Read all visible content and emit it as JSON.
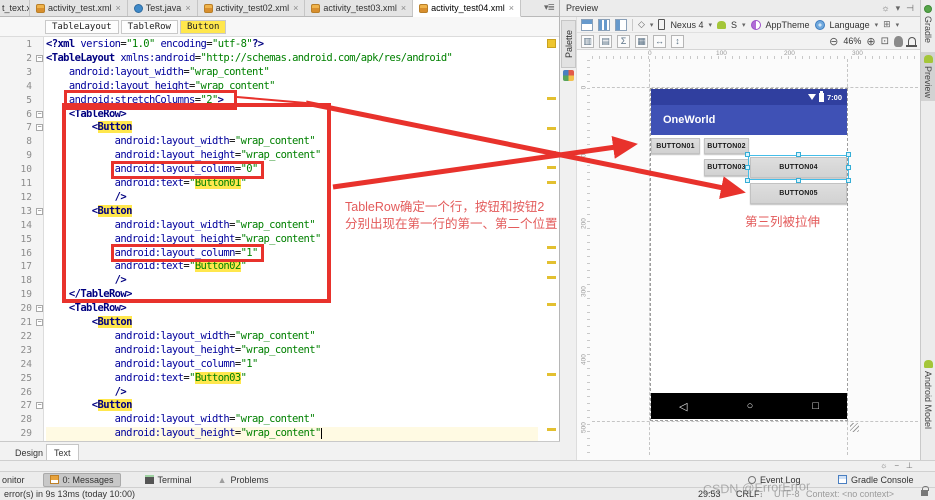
{
  "editor_tabs": [
    {
      "label": "t_text.xm",
      "icon": "xml"
    },
    {
      "label": "activity_test.xml",
      "icon": "xml"
    },
    {
      "label": "Test.java",
      "icon": "cls"
    },
    {
      "label": "activity_test02.xml",
      "icon": "xml"
    },
    {
      "label": "activity_test03.xml",
      "icon": "xml"
    },
    {
      "label": "activity_test04.xml",
      "icon": "xml"
    }
  ],
  "close_glyph": "×",
  "breadcrumbs": [
    "TableLayout",
    "TableRow",
    "Button"
  ],
  "editor": {
    "caret_line": 29,
    "lines": [
      "<?xml version=\"1.0\" encoding=\"utf-8\"?>",
      "<TableLayout xmlns:android=\"http://schemas.android.com/apk/res/android\"",
      "    android:layout_width=\"wrap_content\"",
      "    android:layout_height=\"wrap_content\"",
      "    android:stretchColumns=\"2\">",
      "    <TableRow>",
      "        <Button",
      "            android:layout_width=\"wrap_content\"",
      "            android:layout_height=\"wrap_content\"",
      "            android:layout_column=\"0\"",
      "            android:text=\"Button01\"",
      "            />",
      "        <Button",
      "            android:layout_width=\"wrap_content\"",
      "            android:layout_height=\"wrap_content\"",
      "            android:layout_column=\"1\"",
      "            android:text=\"Button02\"",
      "            />",
      "    </TableRow>",
      "    <TableRow>",
      "        <Button",
      "            android:layout_width=\"wrap_content\"",
      "            android:layout_height=\"wrap_content\"",
      "            android:layout_column=\"1\"",
      "            android:text=\"Button03\"",
      "            />",
      "        <Button",
      "            android:layout_width=\"wrap_content\"",
      "            android:layout_height=\"wrap_content\""
    ]
  },
  "notes": {
    "tablerow_line1": "TableRow确定一个行，按钮和按钮2",
    "tablerow_line2": "分别出现在第一行的第一、第二个位置",
    "stretch": "第三列被拉伸"
  },
  "preview": {
    "title": "Preview",
    "device_selector": "Nexus 4",
    "api_level": "S",
    "theme": "AppTheme",
    "language": "Language",
    "zoom": "46%",
    "ruler_h": [
      "0",
      "100",
      "200",
      "300"
    ],
    "ruler_v": [
      "0",
      "100",
      "200",
      "300",
      "400",
      "500"
    ],
    "phone": {
      "time": "7:00",
      "app_title": "OneWorld",
      "buttons": [
        "BUTTON01",
        "BUTTON02",
        "BUTTON03",
        "BUTTON04",
        "BUTTON05"
      ],
      "nav": {
        "back": "◁",
        "home": "○",
        "recents": "□"
      }
    }
  },
  "right_stripe": {
    "gradle": "Gradle",
    "preview": "Preview",
    "android_model": "Android Model"
  },
  "palette_label": "Palette",
  "bottom": {
    "design": "Design",
    "text": "Text",
    "monitor": "onitor",
    "messages": "0: Messages",
    "terminal": "Terminal",
    "problems": "Problems",
    "event_log": "Event Log",
    "gradle_console": "Gradle Console",
    "status_left": "error(s) in 9s 13ms (today 10:00)",
    "caret_position": "29:53",
    "line_separator": "CRLF",
    "encoding": "UTF-8",
    "context": "Context: <no context>",
    "watermark": "CSDN @ErrorError"
  },
  "colors": {
    "annotation_red": "#e8322c",
    "primary": "#3f51b5",
    "primary_dark": "#303f9f",
    "occurrence_yellow": "#ffe74d",
    "selection_handle": "#35aed6"
  }
}
